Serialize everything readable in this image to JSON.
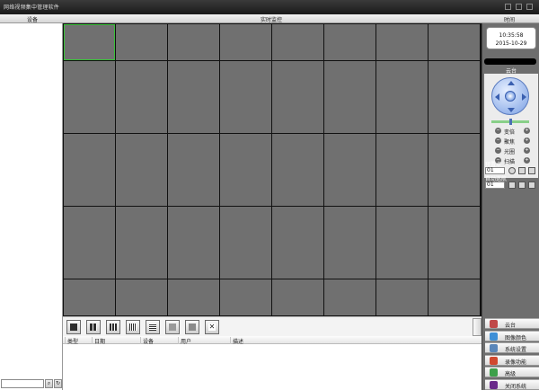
{
  "window": {
    "title": "网络视频集中管理软件"
  },
  "header": {
    "left": "设备",
    "center": "实时监控",
    "right": "时间"
  },
  "clock": {
    "time": "10:35:58",
    "date": "2015-10-29"
  },
  "ptz": {
    "label": "云台",
    "rows": [
      {
        "label": "变倍"
      },
      {
        "label": "聚焦"
      },
      {
        "label": "光圈"
      },
      {
        "label": "扫描"
      }
    ],
    "preset_label": "预置点",
    "preset_value": "01",
    "cruise_label": "自动巡航",
    "cruise_value": "01"
  },
  "grid": {
    "cols": 8,
    "rows": 8,
    "selected_index": 0
  },
  "toolbar": {
    "layouts": [
      "1",
      "4",
      "9",
      "16",
      "25",
      "36",
      "64",
      "full-screen"
    ]
  },
  "log": {
    "columns": [
      "类型",
      "日期",
      "设备",
      "用户",
      "描述"
    ]
  },
  "menu": [
    {
      "label": "云台",
      "icon": "ptz-icon",
      "color": "#c04848"
    },
    {
      "label": "图像颜色",
      "icon": "color-icon",
      "color": "#3e8fd6"
    },
    {
      "label": "系统设置",
      "icon": "settings-icon",
      "color": "#5a86b9"
    },
    {
      "label": "录像功能",
      "icon": "record-icon",
      "color": "#d0492f"
    },
    {
      "label": "高级",
      "icon": "advanced-icon",
      "color": "#3da04a"
    },
    {
      "label": "关闭系统",
      "icon": "power-icon",
      "color": "#6a2b8a"
    }
  ],
  "colors": {
    "cell": "#707070",
    "grid_bg": "#111111",
    "panel": "#6e6e6e",
    "selected": "#39c239"
  }
}
